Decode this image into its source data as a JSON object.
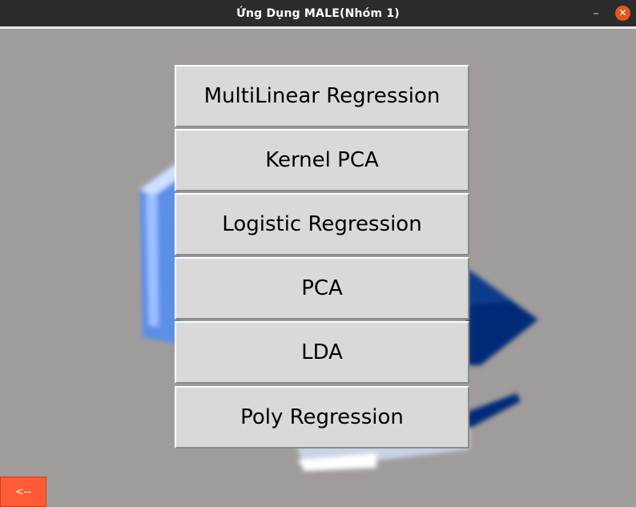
{
  "window": {
    "title": "Ứng Dụng MALE(Nhóm 1)",
    "minimize_glyph": "–",
    "close_glyph": "✕"
  },
  "menu": {
    "buttons": [
      {
        "label": "MultiLinear Regression"
      },
      {
        "label": "Kernel PCA"
      },
      {
        "label": "Logistic Regression"
      },
      {
        "label": "PCA"
      },
      {
        "label": "LDA"
      },
      {
        "label": "Poly Regression"
      }
    ]
  },
  "footer": {
    "back_label": "<--"
  },
  "colors": {
    "background": "#a09c9b",
    "button": "#d9d9d9",
    "back_button": "#ff5a36",
    "close_button": "#e95420"
  }
}
